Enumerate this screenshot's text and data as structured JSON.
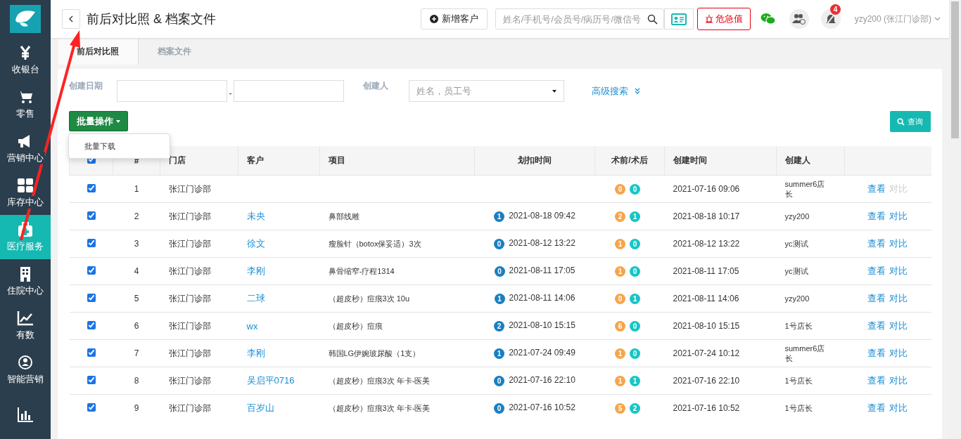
{
  "sidebar": {
    "items": [
      {
        "label": "收银台",
        "selected": false
      },
      {
        "label": "零售",
        "selected": false
      },
      {
        "label": "营销中心",
        "selected": false
      },
      {
        "label": "库存中心",
        "selected": false
      },
      {
        "label": "医疗服务",
        "selected": true
      },
      {
        "label": "住院中心",
        "selected": false
      },
      {
        "label": "有数",
        "selected": false
      },
      {
        "label": "智能营销",
        "selected": false
      },
      {
        "selected": false
      }
    ]
  },
  "header": {
    "title": "前后对比照 & 档案文件",
    "new_customer_button": "新增客户",
    "search": {
      "placeholder": "姓名/手机号/会员号/病历号/微信号"
    },
    "alert_button": "危急值",
    "notification_count": "4",
    "user": "yzy200 (张江门诊部)"
  },
  "tabs": [
    {
      "label": "前后对比照",
      "selected": true
    },
    {
      "label": "档案文件",
      "selected": false
    }
  ],
  "filters": {
    "date_label": "创建日期",
    "date_separator": "-",
    "creator_label": "创建人",
    "creator_placeholder": "姓名，员工号",
    "advanced_search": "高级搜索"
  },
  "batch_button": "批量操作",
  "batch_menu": [
    "批量下载"
  ],
  "query_button": "查询",
  "table": {
    "select_all_checked": true,
    "columns": [
      "#",
      "门店",
      "客户",
      "项目",
      "划扣时间",
      "术前/术后",
      "创建时间",
      "创建人"
    ],
    "rows": [
      {
        "checked": true,
        "index": "1",
        "store": "张江门诊部",
        "before": "0",
        "after": "0",
        "created": "2021-07-16 09:06",
        "creator": "summer6店长",
        "view": "查看",
        "compare": "对比",
        "compare_disabled": true
      },
      {
        "checked": true,
        "index": "2",
        "store": "张江门诊部",
        "customer": "未央",
        "item": "鼻部线雕",
        "deduct_count": "1",
        "deduct_time": "2021-08-18 09:42",
        "before": "2",
        "after": "1",
        "created": "2021-08-18 10:17",
        "creator": "yzy200",
        "view": "查看",
        "compare": "对比",
        "compare_disabled": false
      },
      {
        "checked": true,
        "index": "3",
        "store": "张江门诊部",
        "customer": "徐文",
        "item": "瘦脸针（botox保妥适）3次",
        "deduct_count": "0",
        "deduct_time": "2021-08-12 13:22",
        "before": "1",
        "after": "0",
        "created": "2021-08-12 13:22",
        "creator": "yc测试",
        "view": "查看",
        "compare": "对比",
        "compare_disabled": false
      },
      {
        "checked": true,
        "index": "4",
        "store": "张江门诊部",
        "customer": "李刚",
        "item": "鼻骨缩窄-疗程1314",
        "deduct_count": "0",
        "deduct_time": "2021-08-11 17:05",
        "before": "1",
        "after": "0",
        "created": "2021-08-11 17:05",
        "creator": "yc测试",
        "view": "查看",
        "compare": "对比",
        "compare_disabled": false
      },
      {
        "checked": true,
        "index": "5",
        "store": "张江门诊部",
        "customer": "二球",
        "item": "（超皮秒）痘痕3次  10u",
        "deduct_count": "1",
        "deduct_time": "2021-08-11 14:06",
        "before": "0",
        "after": "1",
        "created": "2021-08-11 14:06",
        "creator": "yzy200",
        "view": "查看",
        "compare": "对比",
        "compare_disabled": false
      },
      {
        "checked": true,
        "index": "6",
        "store": "张江门诊部",
        "customer": "wx",
        "item": "（超皮秒）痘痕",
        "deduct_count": "2",
        "deduct_time": "2021-08-10 15:15",
        "before": "6",
        "after": "0",
        "created": "2021-08-10 15:15",
        "creator": "1号店长",
        "view": "查看",
        "compare": "对比",
        "compare_disabled": false
      },
      {
        "checked": true,
        "index": "7",
        "store": "张江门诊部",
        "customer": "李刚",
        "item": "韩国LG伊婉玻尿酸（1支）",
        "deduct_count": "1",
        "deduct_time": "2021-07-24 09:49",
        "before": "1",
        "after": "0",
        "created": "2021-07-24 10:12",
        "creator": "summer6店长",
        "view": "查看",
        "compare": "对比",
        "compare_disabled": false
      },
      {
        "checked": true,
        "index": "8",
        "store": "张江门诊部",
        "customer": "吴启平0716",
        "item": "（超皮秒）痘痕3次 年卡-医美",
        "deduct_count": "0",
        "deduct_time": "2021-07-16 22:10",
        "before": "1",
        "after": "1",
        "created": "2021-07-16 22:10",
        "creator": "1号店长",
        "view": "查看",
        "compare": "对比",
        "compare_disabled": false
      },
      {
        "checked": true,
        "index": "9",
        "store": "张江门诊部",
        "customer": "百岁山",
        "item": "（超皮秒）痘痕3次 年卡-医美",
        "deduct_count": "0",
        "deduct_time": "2021-07-16 10:52",
        "before": "5",
        "after": "2",
        "created": "2021-07-16 10:52",
        "creator": "1号店长",
        "view": "查看",
        "compare": "对比",
        "compare_disabled": false
      }
    ]
  }
}
